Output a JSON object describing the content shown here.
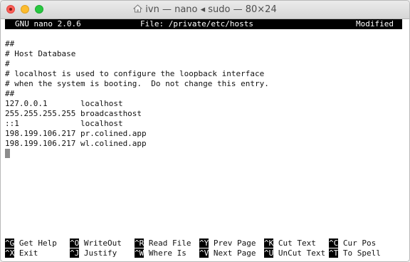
{
  "window": {
    "title": "ivn — nano ◂ sudo — 80×24"
  },
  "nano": {
    "version": "GNU nano 2.0.6",
    "file": "File: /private/etc/hosts",
    "status": "Modified",
    "content": "##\n# Host Database\n#\n# localhost is used to configure the loopback interface\n# when the system is booting.  Do not change this entry.\n##\n127.0.0.1       localhost\n255.255.255.255 broadcasthost\n::1             localhost\n198.199.106.217 pr.colined.app\n198.199.106.217 wl.colined.app",
    "shortcuts": [
      {
        "key": "^G",
        "label": "Get Help"
      },
      {
        "key": "^O",
        "label": "WriteOut"
      },
      {
        "key": "^R",
        "label": "Read File"
      },
      {
        "key": "^Y",
        "label": "Prev Page"
      },
      {
        "key": "^K",
        "label": "Cut Text"
      },
      {
        "key": "^C",
        "label": "Cur Pos"
      },
      {
        "key": "^X",
        "label": "Exit"
      },
      {
        "key": "^J",
        "label": "Justify"
      },
      {
        "key": "^W",
        "label": "Where Is"
      },
      {
        "key": "^V",
        "label": "Next Page"
      },
      {
        "key": "^U",
        "label": "UnCut Text"
      },
      {
        "key": "^T",
        "label": "To Spell"
      }
    ]
  }
}
